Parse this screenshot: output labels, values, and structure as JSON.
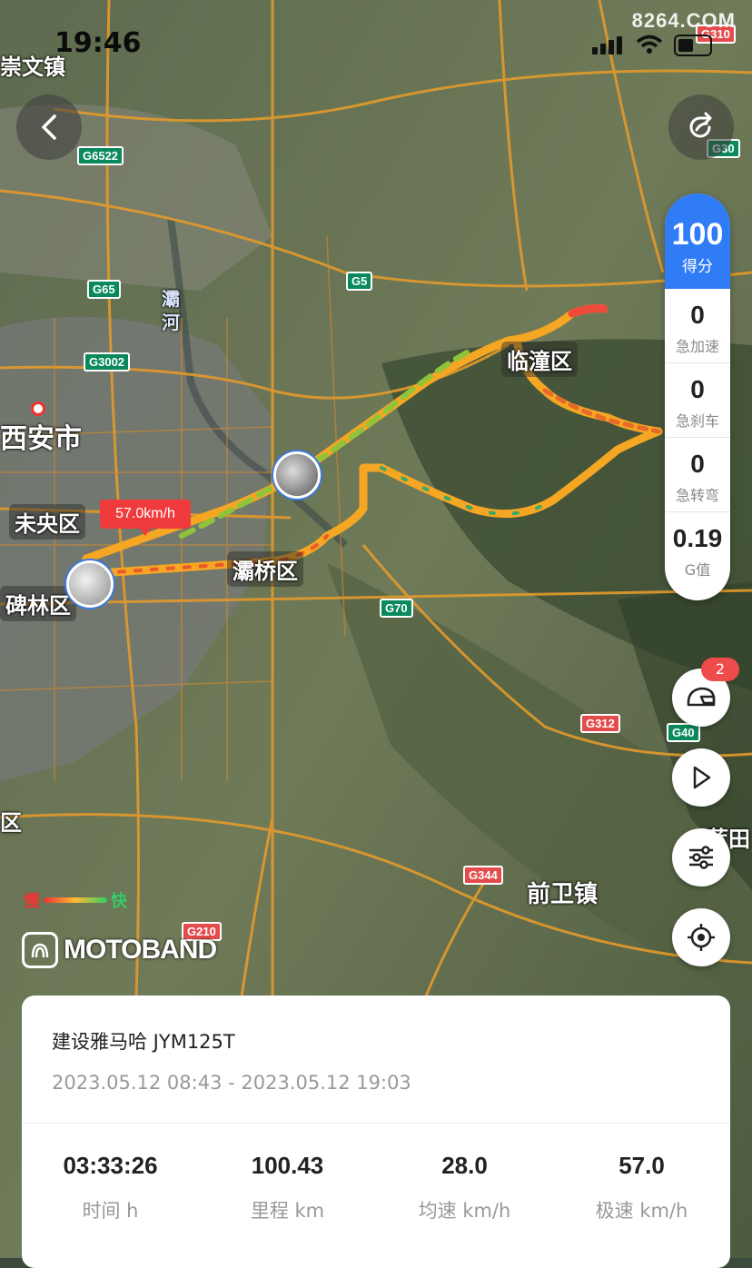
{
  "status_bar": {
    "time": "19:46",
    "watermark": "8264.COM"
  },
  "map": {
    "places": {
      "chongwen": "崇文镇",
      "xian": "西安市",
      "weiyang": "未央区",
      "beilin": "碑林区",
      "baqiao": "灞桥区",
      "lintong": "临潼区",
      "qianwei": "前卫镇",
      "river": "灞河",
      "edge_left": "区",
      "edge_right": "蓝田"
    },
    "shields": {
      "g6522": "G6522",
      "g65": "G65",
      "g3002": "G3002",
      "g5": "G5",
      "g70": "G70",
      "g312": "G312",
      "g40": "G40",
      "g344": "G344",
      "g210": "G210",
      "g30": "G30",
      "g310": "G310"
    },
    "speed_label": "57.0km/h",
    "legend": {
      "slow": "慢",
      "fast": "快"
    },
    "brand": "MOTOBAND"
  },
  "score_panel": {
    "score": "100",
    "score_label": "得分",
    "metrics": [
      {
        "value": "0",
        "label": "急加速"
      },
      {
        "value": "0",
        "label": "急刹车"
      },
      {
        "value": "0",
        "label": "急转弯"
      },
      {
        "value": "0.19",
        "label": "G值"
      }
    ]
  },
  "side_buttons": {
    "helmet_badge": "2"
  },
  "trip": {
    "vehicle": "建设雅马哈 JYM125T",
    "time_range": "2023.05.12 08:43 - 2023.05.12 19:03",
    "stats": [
      {
        "value": "03:33:26",
        "label": "时间 h"
      },
      {
        "value": "100.43",
        "label": "里程 km"
      },
      {
        "value": "28.0",
        "label": "均速 km/h"
      },
      {
        "value": "57.0",
        "label": "极速 km/h"
      }
    ]
  },
  "colors": {
    "accent": "#2f7cf6",
    "speed_badge": "#ef3b3b",
    "route_slow": "#ee3333",
    "route_mid": "#f5a623",
    "route_fast": "#33bb66"
  }
}
